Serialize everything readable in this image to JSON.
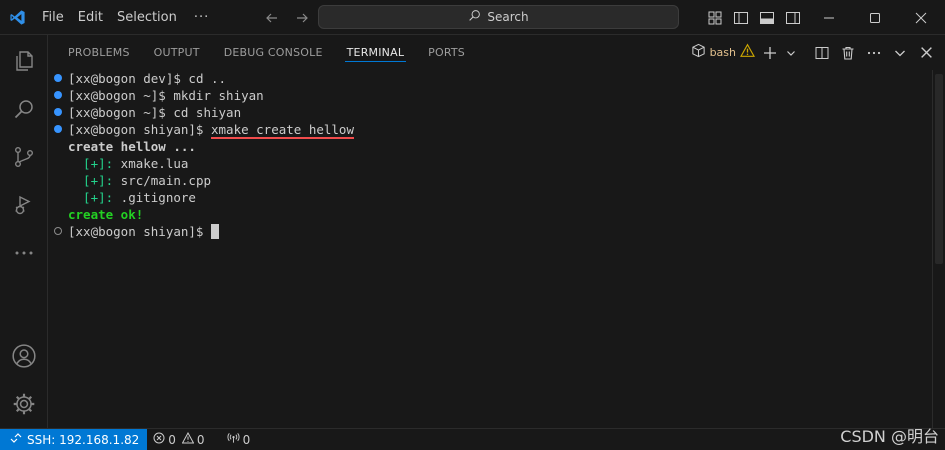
{
  "titlebar": {
    "menu": [
      "File",
      "Edit",
      "Selection"
    ],
    "more": "···",
    "search_placeholder": "Search"
  },
  "panel": {
    "tabs": [
      "PROBLEMS",
      "OUTPUT",
      "DEBUG CONSOLE",
      "TERMINAL",
      "PORTS"
    ],
    "active_tab": "TERMINAL",
    "shell": "bash"
  },
  "terminal": {
    "lines": [
      {
        "prompt": "[xx@bogon dev]$ ",
        "cmd": "cd .."
      },
      {
        "prompt": "[xx@bogon ~]$ ",
        "cmd": "mkdir shiyan"
      },
      {
        "prompt": "[xx@bogon ~]$ ",
        "cmd": "cd shiyan"
      },
      {
        "prompt": "[xx@bogon shiyan]$ ",
        "cmd": "xmake create hellow"
      },
      {
        "text": "create hellow ..."
      },
      {
        "tag": "  [+]:",
        "file": " xmake.lua"
      },
      {
        "tag": "  [+]:",
        "file": " src/main.cpp"
      },
      {
        "tag": "  [+]:",
        "file": " .gitignore"
      },
      {
        "text": "create ok!"
      },
      {
        "prompt": "[xx@bogon shiyan]$ ",
        "cmd": ""
      }
    ]
  },
  "statusbar": {
    "remote": "SSH: 192.168.1.82",
    "errors": "0",
    "warnings": "0",
    "ports": "0"
  },
  "watermark": "CSDN @明台",
  "colors": {
    "accent": "#0078d4",
    "decoration": "#3794ff",
    "warning": "#e2c08d",
    "success_green": "#23d123",
    "tag_green": "#23d18b",
    "underline_red": "#f14c4c"
  }
}
